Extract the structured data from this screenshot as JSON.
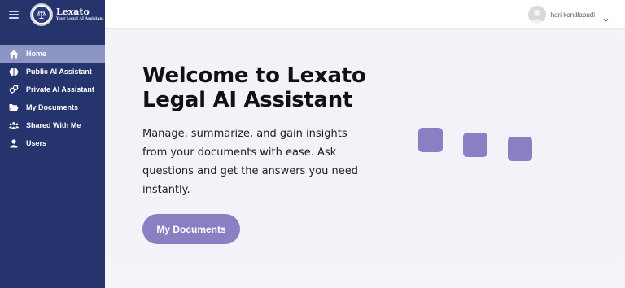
{
  "brand": {
    "title": "Lexato",
    "subtitle": "Your Legal AI Assistant"
  },
  "sidebar": {
    "items": [
      {
        "label": "Home",
        "icon": "home-icon",
        "active": true
      },
      {
        "label": "Public AI Assistant",
        "icon": "brain-icon",
        "active": false
      },
      {
        "label": "Private AI Assistant",
        "icon": "gender-icon",
        "active": false
      },
      {
        "label": "My Documents",
        "icon": "folder-open-icon",
        "active": false
      },
      {
        "label": "Shared With Me",
        "icon": "users-icon",
        "active": false
      },
      {
        "label": "Users",
        "icon": "user-icon",
        "active": false
      }
    ]
  },
  "header": {
    "user_name": "hari kondlapudi"
  },
  "main": {
    "title_line1": "Welcome to Lexato",
    "title_line2": "Legal AI Assistant",
    "description": "Manage, summarize, and gain insights from your documents with ease. Ask questions and get the answers you need instantly.",
    "cta_label": "My Documents"
  },
  "colors": {
    "sidebar_bg": "#26346e",
    "active_item": "#8d95c4",
    "accent": "#8b7fc4",
    "background": "#f3f4f8"
  }
}
